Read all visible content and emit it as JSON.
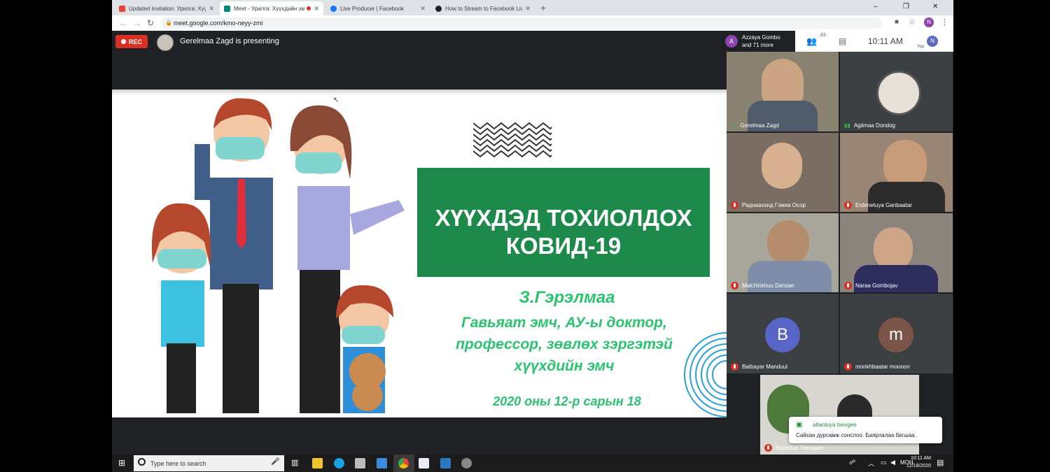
{
  "browser": {
    "tabs": [
      {
        "label": "Updated invitation: Урилга: Хүүх",
        "color": "#ea4335"
      },
      {
        "label": "Meet - Урилга: Хүүхдийн эм",
        "color": "#00897b",
        "active": true
      },
      {
        "label": "Live Producer | Facebook",
        "color": "#1877f2"
      },
      {
        "label": "How to Stream to Facebook Live",
        "color": "#202124"
      }
    ],
    "new_tab": "+",
    "url": "meet.google.com/kmo-neyy-zmi",
    "window_controls": [
      "–",
      "❐",
      "✕"
    ]
  },
  "meet": {
    "rec_label": "REC",
    "presenting_text": "Gerelmaa Zagd is presenting",
    "participants_label": "Azzaya Gombo\nand 71 more",
    "participants_initial": "A",
    "participant_count": "83",
    "time": "10:11 AM",
    "you_label": "You",
    "you_initial": "N"
  },
  "slide": {
    "title": "ХҮҮХДЭД ТОХИОЛДОХ КОВИД-19",
    "presenter_name": "З.Гэрэлмаа",
    "credentials": "Гавьяат эмч, АУ-ы доктор, профессор, зөвлөх зэргэтэй хүүхдийн эмч",
    "date": "2020 оны 12-р сарын 18",
    "title_color": "#1d8a4b",
    "accent_color": "#2bc36f"
  },
  "tiles": [
    {
      "name": "Gerelmaa Zagd",
      "status": "speaking"
    },
    {
      "name": "Agiimaa Dondog",
      "status": "audio"
    },
    {
      "name": "Раднаахэнд Гэмяа Осор",
      "status": "muted"
    },
    {
      "name": "Erdenetuya Ganbaatar",
      "status": "muted"
    },
    {
      "name": "Malchinkhuu Danzan",
      "status": "muted"
    },
    {
      "name": "Naraa Gombojav",
      "status": "muted"
    },
    {
      "name": "Batbayar Manduul",
      "status": "muted",
      "initial": "B",
      "avatar_color": "#5865c7"
    },
    {
      "name": "monkhbaatar moonon",
      "status": "muted",
      "initial": "m",
      "avatar_color": "#7a5548"
    },
    {
      "name": "Bayarbat Tsevegee",
      "status": "muted"
    }
  ],
  "chat": {
    "sender": "altantuya tsevgee",
    "message": "Сайхан дурсамж сонслоо. Баярлалаа багшаа."
  },
  "taskbar": {
    "search_placeholder": "Type here to search",
    "clock_time": "10:11 AM",
    "clock_date": "12/18/2020",
    "language": "МОН"
  }
}
